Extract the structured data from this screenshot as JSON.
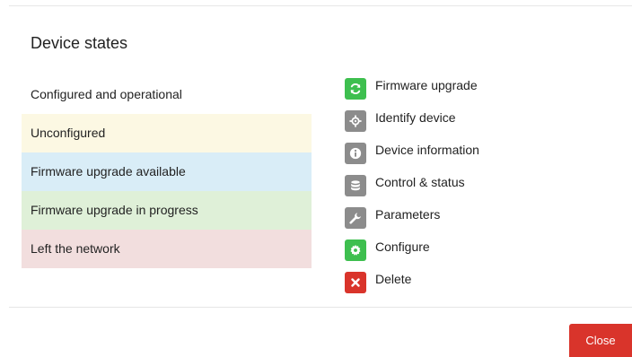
{
  "dialog": {
    "title": "Device states",
    "close_label": "Close"
  },
  "colors": {
    "close_button": "#d9342b",
    "green_icon": "#3ebf4f",
    "gray_icon": "#8c8c8c",
    "red_icon": "#d9342b"
  },
  "states": [
    {
      "label": "Configured and operational",
      "color": "#ffffff"
    },
    {
      "label": "Unconfigured",
      "color": "#fcf8e3"
    },
    {
      "label": "Firmware upgrade available",
      "color": "#d9edf7"
    },
    {
      "label": "Firmware upgrade in progress",
      "color": "#dff0d8"
    },
    {
      "label": "Left the network",
      "color": "#f2dede"
    }
  ],
  "legend": [
    {
      "label": "Firmware upgrade",
      "icon": "refresh-icon",
      "color": "#3ebf4f"
    },
    {
      "label": "Identify device",
      "icon": "crosshair-icon",
      "color": "#8c8c8c"
    },
    {
      "label": "Device information",
      "icon": "info-icon",
      "color": "#8c8c8c"
    },
    {
      "label": "Control & status",
      "icon": "database-icon",
      "color": "#8c8c8c"
    },
    {
      "label": "Parameters",
      "icon": "wrench-icon",
      "color": "#8c8c8c"
    },
    {
      "label": "Configure",
      "icon": "gear-icon",
      "color": "#3ebf4f"
    },
    {
      "label": "Delete",
      "icon": "close-icon",
      "color": "#d9342b"
    }
  ]
}
